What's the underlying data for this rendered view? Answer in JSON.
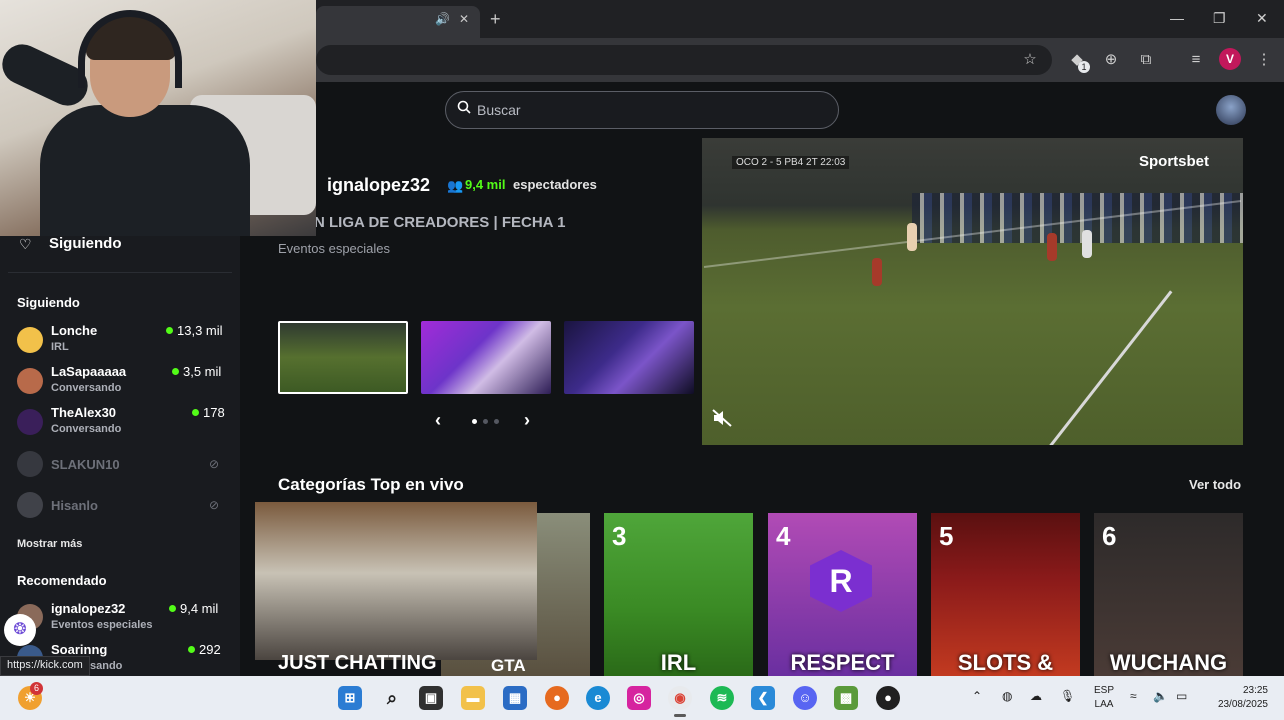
{
  "browser": {
    "new_tab": "+",
    "profile_initial": "V",
    "extension_badge": "1",
    "status_url": "https://kick.com"
  },
  "search": {
    "placeholder": "Buscar"
  },
  "sidebar": {
    "following_nav": "Siguiendo",
    "following_header": "Siguiendo",
    "following": [
      {
        "name": "Lonche",
        "category": "IRL",
        "viewers": "13,3 mil",
        "live": true,
        "avatar_color": "#f2c14a"
      },
      {
        "name": "LaSapaaaaa",
        "category": "Conversando",
        "viewers": "3,5 mil",
        "live": true,
        "avatar_color": "#b86a4a"
      },
      {
        "name": "TheAlex30",
        "category": "Conversando",
        "viewers": "178",
        "live": true,
        "avatar_color": "#6a2fa0"
      },
      {
        "name": "SLAKUN10",
        "live": false,
        "avatar_color": "#4a4d55"
      },
      {
        "name": "Hisanlo",
        "live": false,
        "avatar_color": "#5a5d65"
      }
    ],
    "show_more": "Mostrar más",
    "recommended_header": "Recomendado",
    "recommended": [
      {
        "name": "ignalopez32",
        "category": "Eventos especiales",
        "viewers": "9,4 mil",
        "avatar_color": "#8a6a5a"
      },
      {
        "name": "Soarinng",
        "category": "sando",
        "viewers": "292",
        "avatar_color": "#3a5a8a"
      }
    ]
  },
  "featured": {
    "streamer": "ignalopez32",
    "viewers": "9,4 mil",
    "viewers_label": "espectadores",
    "title": "N LIGA DE CREADORES | FECHA 1",
    "category": "Eventos especiales",
    "scoreboard": "OCO  2 - 5  PB4  2T  22:03",
    "sponsor": "Sportsbet",
    "carousel_prev": "‹",
    "carousel_next": "›"
  },
  "categories": {
    "title": "Categorías Top en vivo",
    "see_all": "Ver todo",
    "items": [
      {
        "rank": "",
        "label": "JUST CHATTING"
      },
      {
        "rank": "",
        "label": "GTA"
      },
      {
        "rank": "3",
        "label": "IRL"
      },
      {
        "rank": "4",
        "label": "RESPECT"
      },
      {
        "rank": "5",
        "label": "SLOTS &"
      },
      {
        "rank": "6",
        "label": "WUCHANG"
      }
    ]
  },
  "taskbar": {
    "notification_count": "6",
    "lang_line1": "ESP",
    "lang_line2": "LAA",
    "time": "23:25",
    "date": "23/08/2025"
  },
  "colors": {
    "accent": "#53fc18",
    "background": "#111315",
    "sidebar": "#191b1f"
  }
}
